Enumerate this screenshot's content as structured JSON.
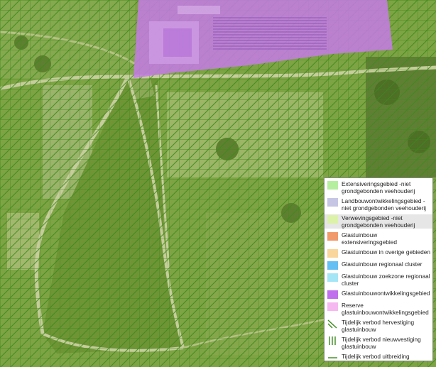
{
  "map": {
    "base_tint": "#6f9a38",
    "hatch_color": "#3a8a1a",
    "purple_zone_color": "#c67be8"
  },
  "legend": {
    "items": [
      {
        "label": "Extensiveringsgebied -niet grondgebonden veehouderij",
        "color": "#b6eea0",
        "kind": "fill",
        "icon": "fill-swatch"
      },
      {
        "label": "Landbouwontwikkelingsgebied -niet grondgebonden veehouderij",
        "color": "#c6c6e4",
        "kind": "fill",
        "icon": "fill-swatch"
      },
      {
        "label": "Verwevingsgebied -niet grondgebonden veehouderij",
        "color": "#dcf2a8",
        "kind": "fill",
        "icon": "fill-swatch",
        "highlight": true
      },
      {
        "label": "Glastuinbouw extensiveringsgebied",
        "color": "#f0996a",
        "kind": "fill",
        "icon": "fill-swatch"
      },
      {
        "label": "Glastuinbouw in overige gebieden",
        "color": "#f8d69c",
        "kind": "fill",
        "icon": "fill-swatch"
      },
      {
        "label": "Glastuinbouw regionaal cluster",
        "color": "#64bff2",
        "kind": "fill",
        "icon": "fill-swatch"
      },
      {
        "label": "Glastuinbouw zoekzone regionaal cluster",
        "color": "#a4e6f6",
        "kind": "fill",
        "icon": "fill-swatch"
      },
      {
        "label": "Glastuinbouwontwikkelingsgebied",
        "color": "#c070ec",
        "kind": "fill",
        "icon": "fill-swatch"
      },
      {
        "label": "Reserve glastuinbouwontwikkelingsgebied",
        "color": "#f6b8f0",
        "kind": "fill",
        "icon": "fill-swatch"
      },
      {
        "label": "Tijdelijk verbod hervestiging glastuinbouw",
        "color": "#3a8a1a",
        "kind": "diagonal",
        "icon": "diagonal-lines-icon"
      },
      {
        "label": "Tijdelijk verbod nieuwvestiging glastuinbouw",
        "color": "#3a8a1a",
        "kind": "vertical",
        "icon": "vertical-lines-icon"
      },
      {
        "label": "Tijdelijk verbod uitbreiding bestaande glastuinbouw",
        "color": "#3a8a1a",
        "kind": "horizontal",
        "icon": "horizontal-lines-icon"
      }
    ]
  }
}
